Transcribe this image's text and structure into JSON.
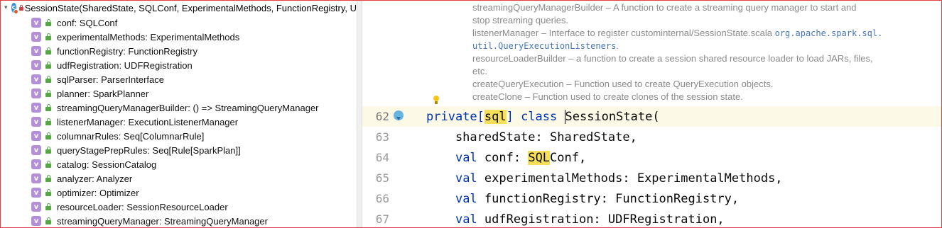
{
  "structure": {
    "root_label": "SessionState(SharedState, SQLConf, ExperimentalMethods, FunctionRegistry, U",
    "root_icon": "class-icon",
    "member_icon_letter": "v",
    "members": [
      "conf: SQLConf",
      "experimentalMethods: ExperimentalMethods",
      "functionRegistry: FunctionRegistry",
      "udfRegistration: UDFRegistration",
      "sqlParser: ParserInterface",
      "planner: SparkPlanner",
      "streamingQueryManagerBuilder: () => StreamingQueryManager",
      "listenerManager: ExecutionListenerManager",
      "columnarRules: Seq[ColumnarRule]",
      "queryStagePrepRules: Seq[Rule[SparkPlan]]",
      "catalog: SessionCatalog",
      "analyzer: Analyzer",
      "optimizer: Optimizer",
      "resourceLoader: SessionResourceLoader",
      "streamingQueryManager: StreamingQueryManager"
    ]
  },
  "doc": {
    "lines": [
      {
        "text": "streamingQueryManagerBuilder – A function to create a streaming query manager to start and",
        "code": ""
      },
      {
        "text": "stop streaming queries.",
        "code": ""
      },
      {
        "text": "listenerManager – Interface to register custominternal/SessionState.scala ",
        "code": "org.apache.spark.sql."
      },
      {
        "text": "",
        "code": "util.QueryExecutionListeners",
        "suffix": "."
      },
      {
        "text": "resourceLoaderBuilder – a function to create a session shared resource loader to load JARs, files,",
        "code": ""
      },
      {
        "text": "etc.",
        "code": ""
      },
      {
        "text": "createQueryExecution – Function used to create QueryExecution objects.",
        "code": ""
      },
      {
        "text": "createClone – Function used to create clones of the session state.",
        "code": ""
      }
    ]
  },
  "code": {
    "lines": [
      {
        "num": "62",
        "current": true
      },
      {
        "num": "63",
        "text": "    sharedState: SharedState,"
      },
      {
        "num": "64"
      },
      {
        "num": "65",
        "kw": "val",
        "text": " experimentalMethods: ExperimentalMethods,"
      },
      {
        "num": "66",
        "kw": "val",
        "text": " functionRegistry: FunctionRegistry,"
      },
      {
        "num": "67",
        "kw": "val",
        "text": " udfRegistration: UDFRegistration,"
      }
    ],
    "line62": {
      "kw1": "private[",
      "hl1": "sql",
      "kw2": "] class ",
      "rest": "SessionState("
    },
    "line64": {
      "indent": "    ",
      "kw": "val",
      "mid": " conf: ",
      "hl": "SQL",
      "rest": "Conf,"
    }
  },
  "colors": {
    "keyword": "#0033b3",
    "highlight": "#f6e05a",
    "member_icon": "#b48fd8",
    "class_icon": "#3b8fd6"
  }
}
